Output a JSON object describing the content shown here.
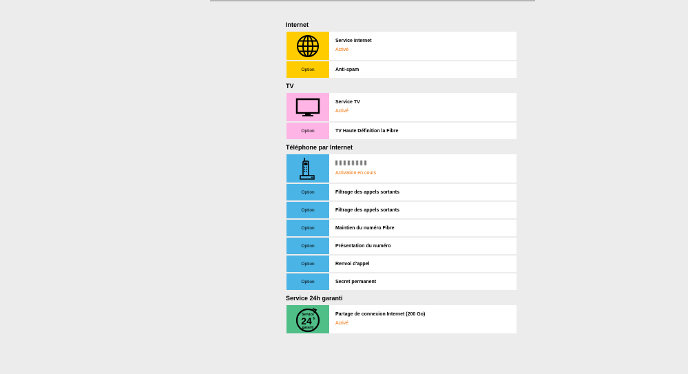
{
  "sections": [
    {
      "title": "Internet",
      "service": {
        "name": "Service internet",
        "status": "Activé",
        "icon": "globe-icon",
        "color": "#ffcc00"
      },
      "options": [
        {
          "label": "Option",
          "name": "Anti-spam"
        }
      ]
    },
    {
      "title": "TV",
      "service": {
        "name": "Service TV",
        "status": "Activé",
        "icon": "tv-icon",
        "color": "#ffb4e6"
      },
      "options": [
        {
          "label": "Option",
          "name": "TV Haute Définition la Fibre"
        }
      ]
    },
    {
      "title": "Téléphone par Internet",
      "service": {
        "name": "",
        "status": "Activation en cours",
        "icon": "phone-icon",
        "color": "#4bb4e6"
      },
      "options": [
        {
          "label": "Option",
          "name": "Filtrage des appels sortants"
        },
        {
          "label": "Option",
          "name": "Filtrage des appels sortants"
        },
        {
          "label": "Option",
          "name": "Maintien du numéro Fibre"
        },
        {
          "label": "Option",
          "name": "Présentation du numéro"
        },
        {
          "label": "Option",
          "name": "Renvoi d'appel"
        },
        {
          "label": "Option",
          "name": "Secret permanent"
        }
      ]
    },
    {
      "title": "Service 24h garanti",
      "service": {
        "name": "Partage de connexion Internet (200 Go)",
        "status": "Activé",
        "icon": "service-24h-icon",
        "color": "#50be87"
      },
      "icon_text": {
        "top": "Service",
        "mid": "24",
        "sup": "h",
        "bottom": "garanti"
      },
      "options": []
    }
  ],
  "colors": {
    "status": "#f16e00",
    "background": "#ececec"
  }
}
